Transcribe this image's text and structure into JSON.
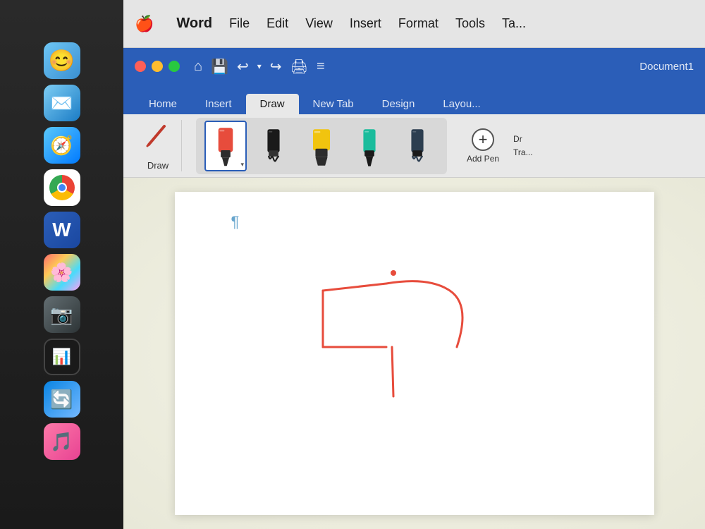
{
  "menubar": {
    "apple_symbol": "🍎",
    "items": [
      {
        "id": "word",
        "label": "Word",
        "bold": true
      },
      {
        "id": "file",
        "label": "File"
      },
      {
        "id": "edit",
        "label": "Edit"
      },
      {
        "id": "view",
        "label": "View"
      },
      {
        "id": "insert",
        "label": "Insert"
      },
      {
        "id": "format",
        "label": "Format"
      },
      {
        "id": "tools",
        "label": "Tools"
      },
      {
        "id": "table",
        "label": "Ta..."
      }
    ]
  },
  "titlebar": {
    "document_name": "Document1"
  },
  "tabs": [
    {
      "id": "home",
      "label": "Home",
      "active": false
    },
    {
      "id": "insert",
      "label": "Insert",
      "active": false
    },
    {
      "id": "draw",
      "label": "Draw",
      "active": true
    },
    {
      "id": "newtab",
      "label": "New Tab",
      "active": false
    },
    {
      "id": "design",
      "label": "Design",
      "active": false
    },
    {
      "id": "layout",
      "label": "Layou...",
      "active": false
    }
  ],
  "toolbar": {
    "draw_label": "Draw",
    "add_pen_label": "Add Pen",
    "dr_tra_label": "Dr\nTra..."
  },
  "pens": [
    {
      "id": "pen1",
      "color": "#e74c3c",
      "tip": "round",
      "selected": true
    },
    {
      "id": "pen2",
      "color": "#1a1a1a",
      "tip": "wave",
      "selected": false
    },
    {
      "id": "pen3",
      "color": "#f1c40f",
      "tip": "flat",
      "selected": false
    },
    {
      "id": "pen4",
      "color": "#1abc9c",
      "tip": "round",
      "selected": false
    },
    {
      "id": "pen5",
      "color": "#2c3e50",
      "tip": "wave",
      "selected": false
    }
  ],
  "document": {
    "paragraph_symbol": "¶"
  },
  "dock": {
    "items": [
      {
        "id": "finder",
        "label": "Finder",
        "emoji": "😊"
      },
      {
        "id": "mail",
        "label": "Mail",
        "emoji": "✉️"
      },
      {
        "id": "safari",
        "label": "Safari",
        "emoji": "🧭"
      },
      {
        "id": "chrome",
        "label": "Chrome",
        "type": "chrome"
      },
      {
        "id": "word",
        "label": "Word",
        "type": "word"
      },
      {
        "id": "photos",
        "label": "Photos",
        "emoji": "🌸"
      },
      {
        "id": "image-capture",
        "label": "Image Capture",
        "emoji": "📷"
      },
      {
        "id": "activity",
        "label": "Activity Monitor",
        "emoji": "📊"
      },
      {
        "id": "migration",
        "label": "Migration Assistant",
        "emoji": "🔄"
      },
      {
        "id": "music",
        "label": "Music",
        "emoji": "🎵"
      }
    ]
  }
}
